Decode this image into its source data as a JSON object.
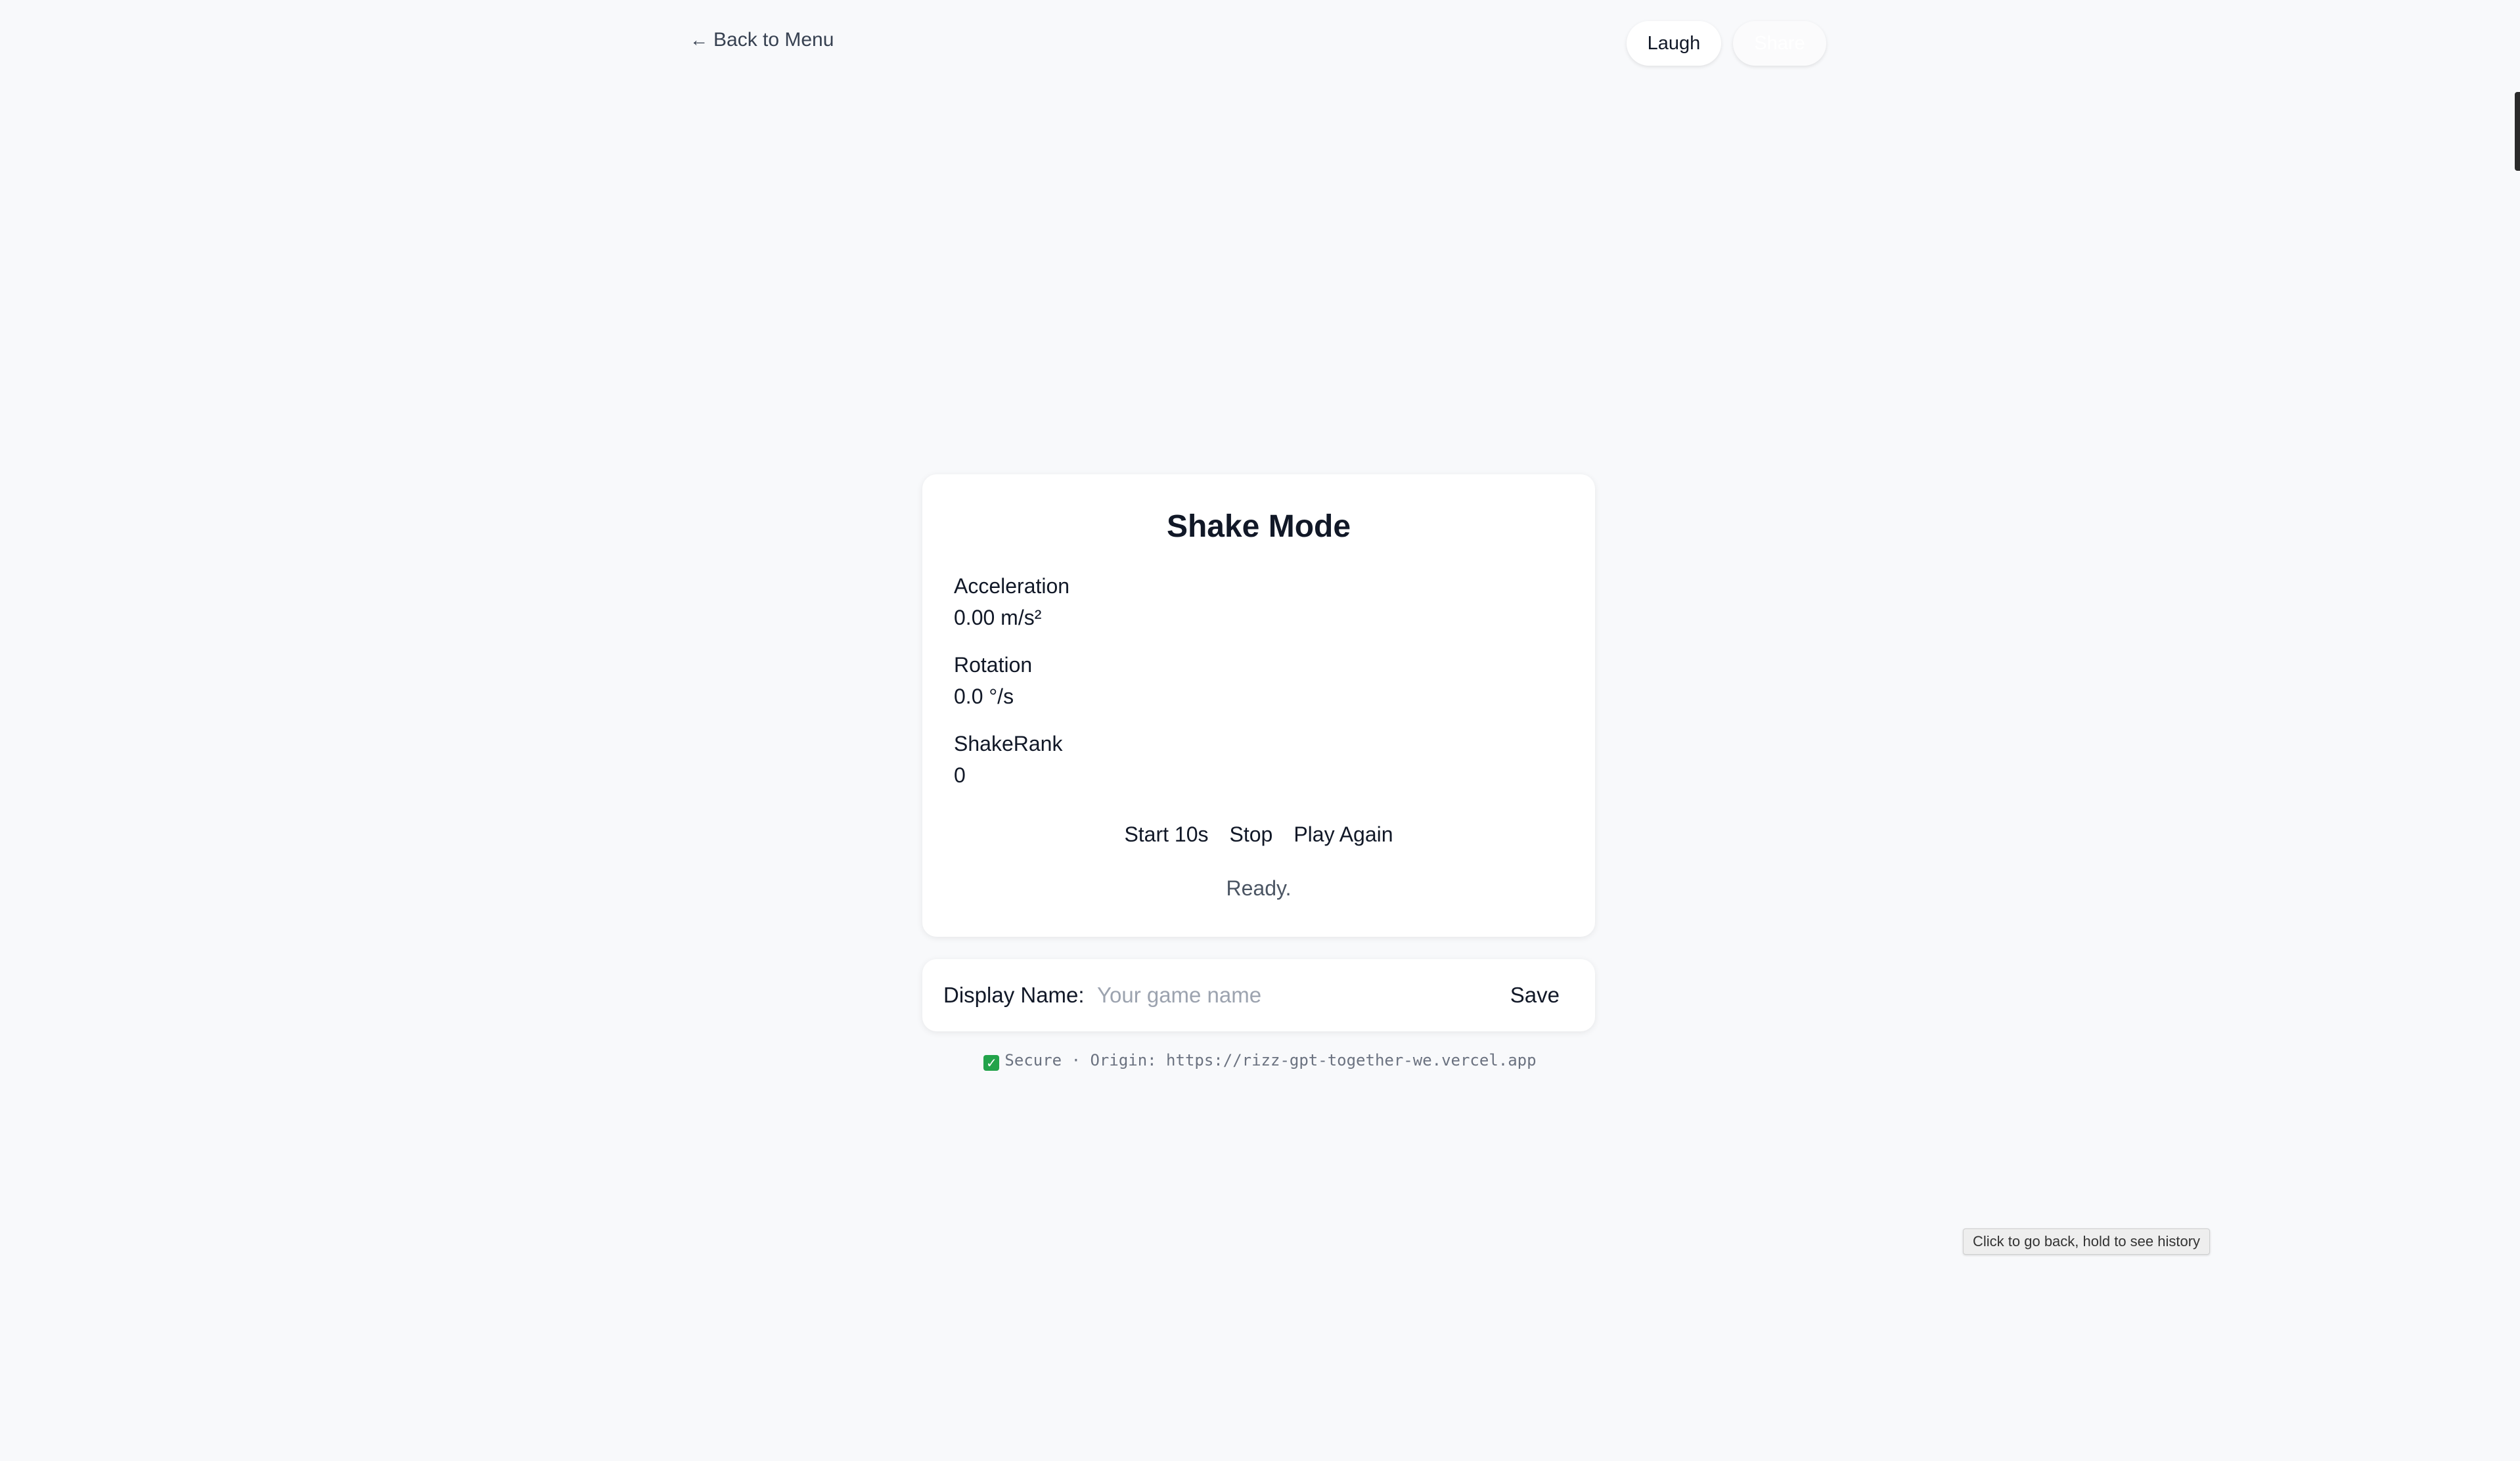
{
  "nav": {
    "back_label": "Back to Menu",
    "back_icon": "arrow-left-icon"
  },
  "toolbar": {
    "laugh_label": "Laugh",
    "share_label": "Share"
  },
  "card": {
    "title": "Shake Mode",
    "stats": [
      {
        "label": "Acceleration",
        "value": "0.00 m/s²"
      },
      {
        "label": "Rotation",
        "value": "0.0 °/s"
      },
      {
        "label": "ShakeRank",
        "value": "0"
      }
    ],
    "actions": {
      "start_label": "Start 10s",
      "stop_label": "Stop",
      "play_again_label": "Play Again"
    },
    "status": "Ready."
  },
  "name_bar": {
    "label": "Display Name:",
    "placeholder": "Your game name",
    "value": "",
    "save_label": "Save"
  },
  "secure": {
    "text": "Secure · Origin: https://rizz-gpt-together-we.vercel.app",
    "icon": "check-icon",
    "icon_color": "#22a34a"
  },
  "tooltip": {
    "text": "Click to go back, hold to see history"
  }
}
